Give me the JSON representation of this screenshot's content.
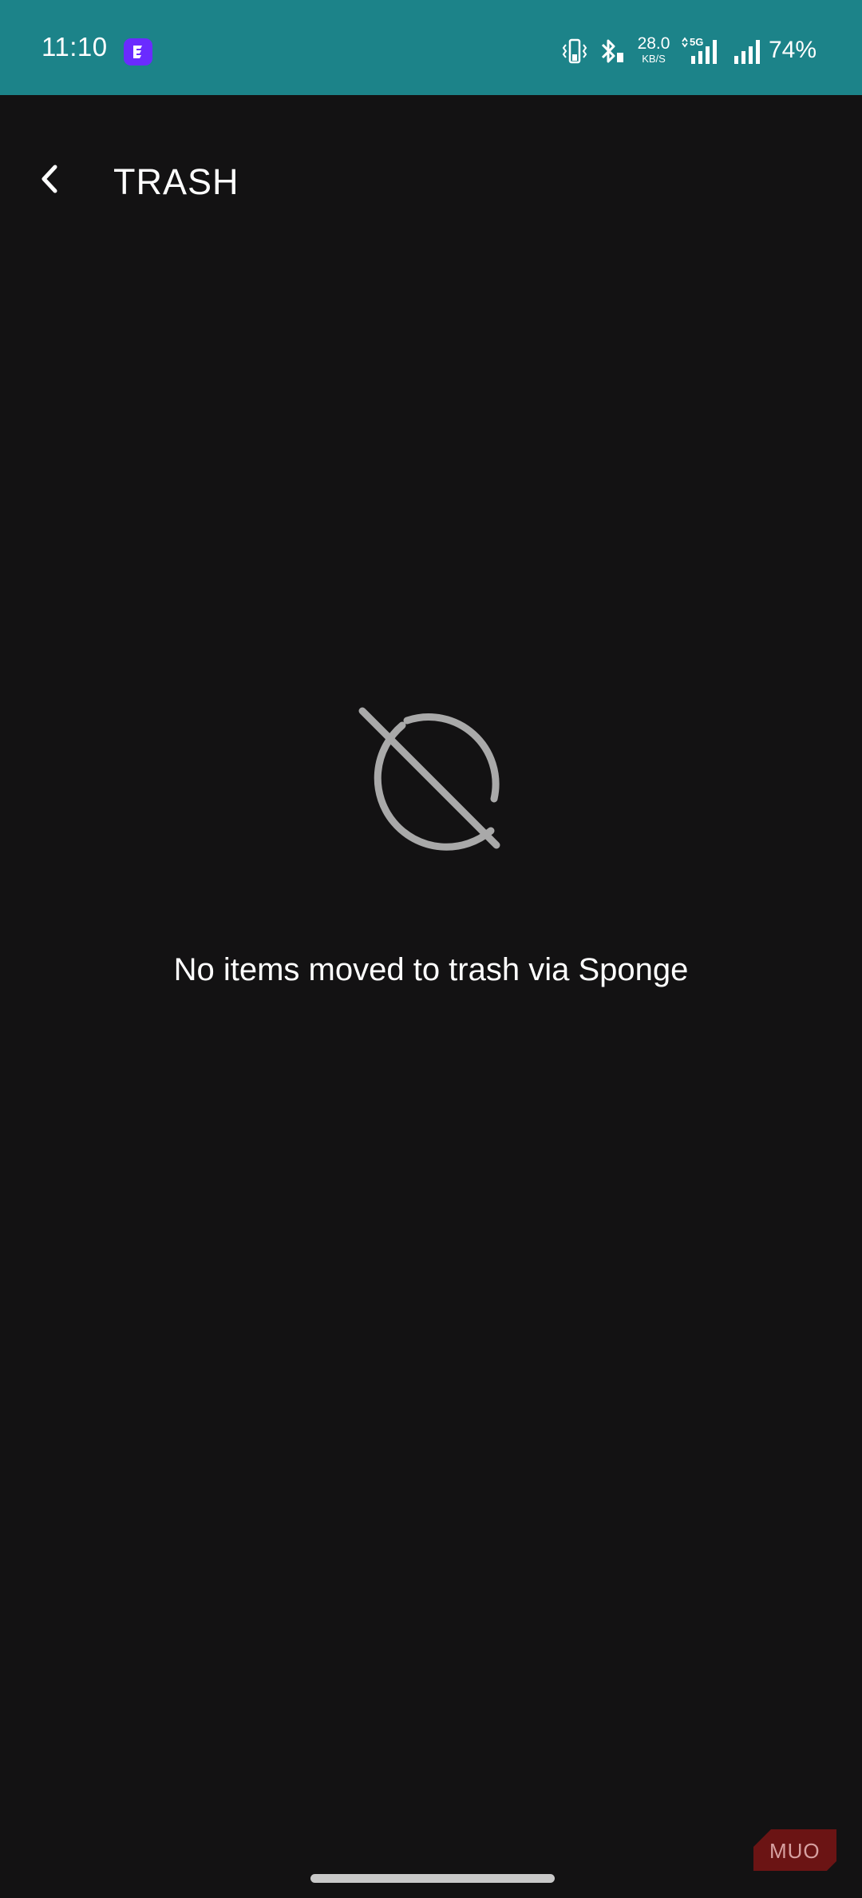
{
  "status_bar": {
    "time": "11:10",
    "net_speed_value": "28.0",
    "net_speed_unit": "KB/S",
    "network_type": "5G",
    "battery": "74%",
    "background_color": "#1c8389",
    "app_badge_color": "#6a2bff"
  },
  "header": {
    "title": "TRASH",
    "back_icon": "chevron-left-icon"
  },
  "empty_state": {
    "icon": "disabled-circle-icon",
    "message": "No items moved to trash via Sponge"
  },
  "watermark": {
    "text": "MUO"
  },
  "colors": {
    "background": "#131213",
    "icon_gray": "#a9a9a9"
  }
}
